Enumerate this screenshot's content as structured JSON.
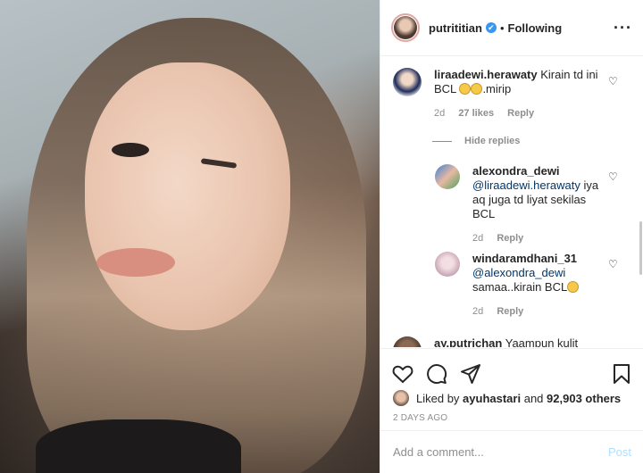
{
  "header": {
    "username": "putrititian",
    "verified_glyph": "✔",
    "separator": "•",
    "follow_status": "Following",
    "more_glyph": "···"
  },
  "comments": [
    {
      "user": "liraadewi.herawaty",
      "text_before": "Kirain td ini BCL",
      "text_after": ".mirip",
      "time": "2d",
      "likes": "27 likes",
      "reply_label": "Reply"
    }
  ],
  "hide_replies_label": "Hide replies",
  "replies": [
    {
      "user": "alexondra_dewi",
      "mention": "@liraadewi.herawaty",
      "text": "iya aq juga td liyat sekilas BCL",
      "time": "2d",
      "reply_label": "Reply"
    },
    {
      "user": "windaramdhani_31",
      "mention": "@alexondra_dewi",
      "text": "samaa..kirain BCL",
      "time": "2d",
      "reply_label": "Reply"
    }
  ],
  "partial_comment": {
    "user": "ay.putrichan",
    "text": "Yaampun kulit"
  },
  "likes": {
    "prefix": "Liked by",
    "user": "ayuhastari",
    "middle": "and",
    "count": "92,903 others"
  },
  "timestamp": "2 DAYS AGO",
  "add_comment": {
    "placeholder": "Add a comment...",
    "post_label": "Post"
  },
  "icons": {
    "like": "heart-icon",
    "comment": "comment-icon",
    "share": "send-icon",
    "save": "bookmark-icon"
  }
}
